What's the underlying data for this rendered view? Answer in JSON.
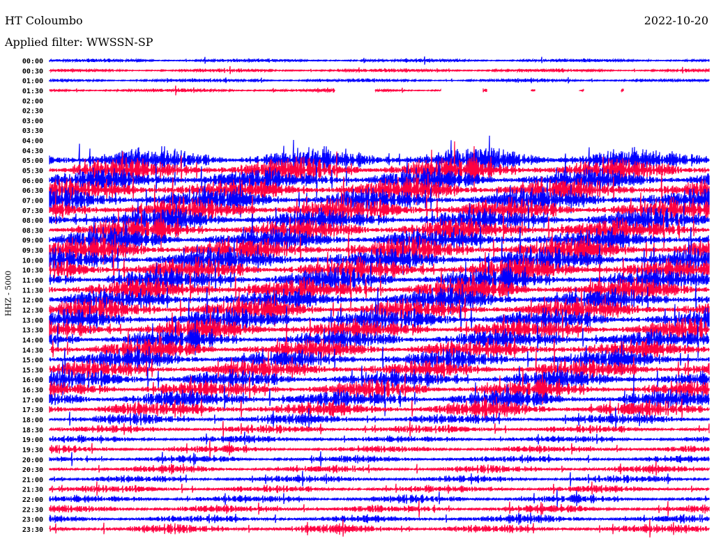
{
  "header": {
    "station": "HT Coloumbo",
    "date": "2022-10-20",
    "filter_label": "Applied filter: WWSSN-SP"
  },
  "chart_data": {
    "type": "line",
    "subtype": "helicorder",
    "title": "HT Coloumbo",
    "ylabel": "HHZ - 5000",
    "minutes_per_row": 30,
    "colors": [
      "#0000ff",
      "#ff0040"
    ],
    "row_labels": [
      "00:00",
      "00:30",
      "01:00",
      "01:30",
      "02:00",
      "02:30",
      "03:00",
      "03:30",
      "04:00",
      "04:30",
      "05:00",
      "05:30",
      "06:00",
      "06:30",
      "07:00",
      "07:30",
      "08:00",
      "08:30",
      "09:00",
      "09:30",
      "10:00",
      "10:30",
      "11:00",
      "11:30",
      "12:00",
      "12:30",
      "13:00",
      "13:30",
      "14:00",
      "14:30",
      "15:00",
      "15:30",
      "16:00",
      "16:30",
      "17:00",
      "17:30",
      "18:00",
      "18:30",
      "19:00",
      "19:30",
      "20:00",
      "20:30",
      "21:00",
      "21:30",
      "22:00",
      "22:30",
      "23:00",
      "23:30"
    ],
    "relative_amplitude": [
      0.25,
      0.25,
      0.25,
      0.25,
      0,
      0,
      0,
      0,
      0,
      0,
      1.6,
      1.6,
      1.5,
      1.5,
      1.5,
      1.5,
      1.5,
      1.5,
      1.5,
      1.5,
      1.5,
      1.5,
      1.5,
      1.5,
      1.4,
      1.4,
      1.4,
      1.4,
      1.3,
      1.3,
      1.2,
      1.2,
      1.2,
      1.2,
      1.2,
      1.1,
      0.7,
      0.55,
      0.5,
      0.5,
      0.5,
      0.5,
      0.5,
      0.5,
      0.55,
      0.55,
      0.55,
      0.6
    ],
    "partial_row": {
      "label": "01:30",
      "data_segments_minutes": [
        [
          0,
          13.0
        ],
        [
          14.8,
          17.8
        ],
        [
          19.7,
          19.9
        ],
        [
          21.9,
          22.1
        ],
        [
          24.1,
          24.3
        ],
        [
          26.0,
          26.1
        ]
      ]
    }
  }
}
